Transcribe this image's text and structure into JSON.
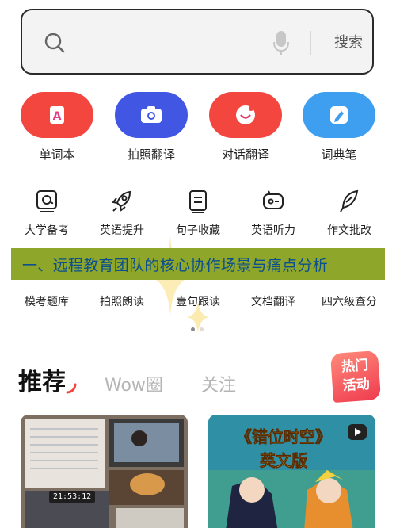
{
  "search": {
    "button_label": "搜索",
    "placeholder": ""
  },
  "features": [
    {
      "label": "单词本",
      "icon": "book-a-icon",
      "color": "#f2463f"
    },
    {
      "label": "拍照翻译",
      "icon": "camera-icon",
      "color": "#4157e4"
    },
    {
      "label": "对话翻译",
      "icon": "chat-icon",
      "color": "#f2463f"
    },
    {
      "label": "词典笔",
      "icon": "pen-icon",
      "color": "#3e9ff0"
    }
  ],
  "tools_row1": [
    {
      "label": "大学备考",
      "icon": "at-book-icon"
    },
    {
      "label": "英语提升",
      "icon": "rocket-icon"
    },
    {
      "label": "句子收藏",
      "icon": "notebook-icon"
    },
    {
      "label": "英语听力",
      "icon": "headphone-icon"
    },
    {
      "label": "作文批改",
      "icon": "feather-icon"
    }
  ],
  "tools_row2": [
    {
      "label": "模考题库"
    },
    {
      "label": "拍照朗读"
    },
    {
      "label": "壹句跟读"
    },
    {
      "label": "文档翻译"
    },
    {
      "label": "四六级查分"
    }
  ],
  "banner": {
    "text": "一、远程教育团队的核心协作场景与痛点分析",
    "bg_color": "#8ea629",
    "text_color": "#0b4f8f"
  },
  "page_indicator": {
    "count": 2,
    "active": 0
  },
  "feed_tabs": {
    "recommend": "推荐",
    "wow": "Wow圈",
    "follow": "关注"
  },
  "hot_badge": {
    "line1": "热门",
    "line2": "活动"
  },
  "cards": [
    {
      "time_text": "21:53:12"
    },
    {
      "title_line1": "《错位时空》",
      "title_line2": "英文版"
    }
  ]
}
